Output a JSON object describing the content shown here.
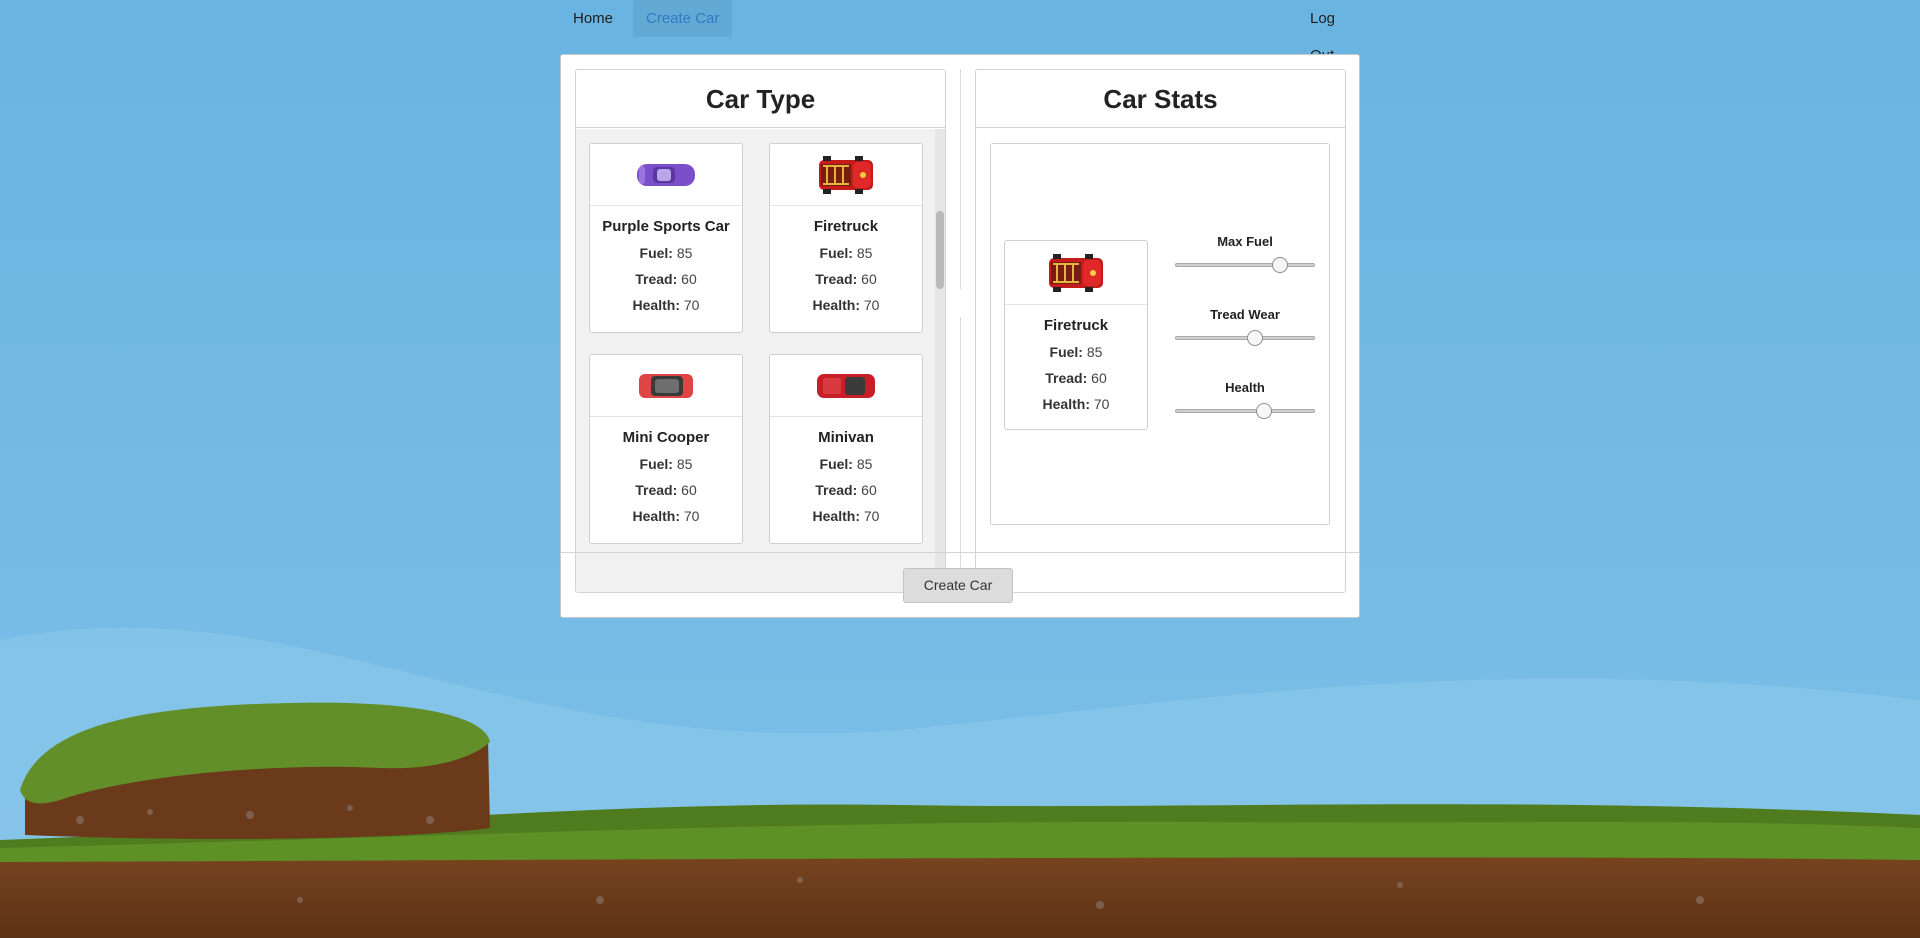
{
  "nav": {
    "home": "Home",
    "create_car": "Create Car",
    "logout": "Log Out"
  },
  "car_type": {
    "title": "Car Type",
    "cars": [
      {
        "name": "Purple Sports Car",
        "fuel_label": "Fuel:",
        "fuel": "85",
        "tread_label": "Tread:",
        "tread": "60",
        "health_label": "Health:",
        "health": "70",
        "icon": "purple-sports-car-icon",
        "color": "#7b4fc9"
      },
      {
        "name": "Firetruck",
        "fuel_label": "Fuel:",
        "fuel": "85",
        "tread_label": "Tread:",
        "tread": "60",
        "health_label": "Health:",
        "health": "70",
        "icon": "firetruck-icon",
        "color": "#d42020"
      },
      {
        "name": "Mini Cooper",
        "fuel_label": "Fuel:",
        "fuel": "85",
        "tread_label": "Tread:",
        "tread": "60",
        "health_label": "Health:",
        "health": "70",
        "icon": "mini-cooper-icon",
        "color": "#e04040"
      },
      {
        "name": "Minivan",
        "fuel_label": "Fuel:",
        "fuel": "85",
        "tread_label": "Tread:",
        "tread": "60",
        "health_label": "Health:",
        "health": "70",
        "icon": "minivan-icon",
        "color": "#c81e28"
      }
    ]
  },
  "car_stats": {
    "title": "Car Stats",
    "selected": {
      "name": "Firetruck",
      "fuel_label": "Fuel:",
      "fuel": "85",
      "tread_label": "Tread:",
      "tread": "60",
      "health_label": "Health:",
      "health": "70",
      "icon": "firetruck-icon"
    },
    "sliders": [
      {
        "label": "Max Fuel",
        "level": 0.75
      },
      {
        "label": "Tread Wear",
        "level": 0.57
      },
      {
        "label": "Health",
        "level": 0.64
      }
    ]
  },
  "actions": {
    "create_car": "Create Car"
  }
}
